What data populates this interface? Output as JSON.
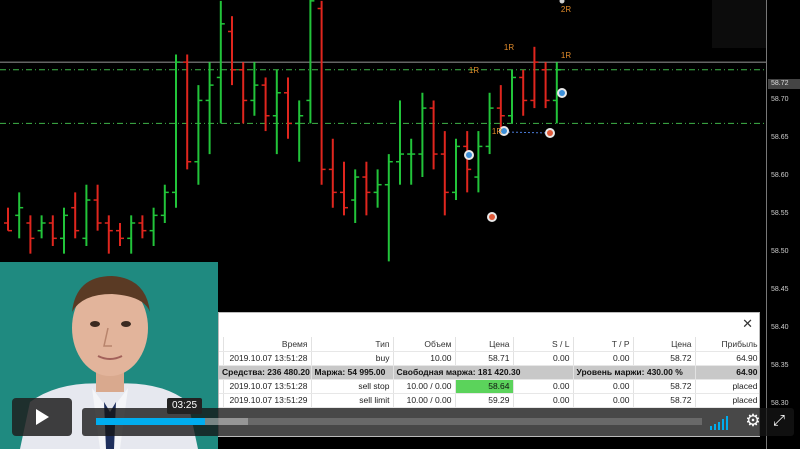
{
  "price_axis": {
    "current_price": "58.72",
    "labels": [
      "58.70",
      "58.65",
      "58.60",
      "58.55",
      "58.50",
      "58.45",
      "58.40",
      "58.35",
      "58.30"
    ]
  },
  "annotations": [
    "2R",
    "1R",
    "1R",
    "1R",
    "1R"
  ],
  "chart_data": {
    "type": "ohlc",
    "title": "",
    "ylim": [
      58.28,
      58.78
    ],
    "bars": [
      {
        "o": 58.51,
        "h": 58.53,
        "l": 58.5,
        "c": 58.5,
        "dir": "down"
      },
      {
        "o": 58.52,
        "h": 58.55,
        "l": 58.49,
        "c": 58.53,
        "dir": "up"
      },
      {
        "o": 58.51,
        "h": 58.52,
        "l": 58.47,
        "c": 58.49,
        "dir": "down"
      },
      {
        "o": 58.5,
        "h": 58.52,
        "l": 58.49,
        "c": 58.51,
        "dir": "up"
      },
      {
        "o": 58.51,
        "h": 58.52,
        "l": 58.48,
        "c": 58.49,
        "dir": "down"
      },
      {
        "o": 58.49,
        "h": 58.53,
        "l": 58.47,
        "c": 58.52,
        "dir": "up"
      },
      {
        "o": 58.53,
        "h": 58.55,
        "l": 58.49,
        "c": 58.5,
        "dir": "down"
      },
      {
        "o": 58.49,
        "h": 58.56,
        "l": 58.48,
        "c": 58.54,
        "dir": "up"
      },
      {
        "o": 58.54,
        "h": 58.56,
        "l": 58.5,
        "c": 58.51,
        "dir": "down"
      },
      {
        "o": 58.51,
        "h": 58.52,
        "l": 58.47,
        "c": 58.5,
        "dir": "down"
      },
      {
        "o": 58.5,
        "h": 58.51,
        "l": 58.48,
        "c": 58.49,
        "dir": "down"
      },
      {
        "o": 58.49,
        "h": 58.52,
        "l": 58.47,
        "c": 58.51,
        "dir": "up"
      },
      {
        "o": 58.51,
        "h": 58.52,
        "l": 58.49,
        "c": 58.5,
        "dir": "down"
      },
      {
        "o": 58.5,
        "h": 58.53,
        "l": 58.48,
        "c": 58.52,
        "dir": "up"
      },
      {
        "o": 58.52,
        "h": 58.56,
        "l": 58.51,
        "c": 58.55,
        "dir": "up"
      },
      {
        "o": 58.55,
        "h": 58.73,
        "l": 58.53,
        "c": 58.72,
        "dir": "up"
      },
      {
        "o": 58.72,
        "h": 58.73,
        "l": 58.58,
        "c": 58.59,
        "dir": "down"
      },
      {
        "o": 58.59,
        "h": 58.69,
        "l": 58.56,
        "c": 58.67,
        "dir": "up"
      },
      {
        "o": 58.67,
        "h": 58.72,
        "l": 58.6,
        "c": 58.69,
        "dir": "up"
      },
      {
        "o": 58.7,
        "h": 58.8,
        "l": 58.64,
        "c": 58.77,
        "dir": "up"
      },
      {
        "o": 58.76,
        "h": 58.78,
        "l": 58.69,
        "c": 58.71,
        "dir": "down"
      },
      {
        "o": 58.71,
        "h": 58.72,
        "l": 58.64,
        "c": 58.67,
        "dir": "down"
      },
      {
        "o": 58.67,
        "h": 58.72,
        "l": 58.65,
        "c": 58.69,
        "dir": "up"
      },
      {
        "o": 58.69,
        "h": 58.7,
        "l": 58.63,
        "c": 58.65,
        "dir": "down"
      },
      {
        "o": 58.65,
        "h": 58.71,
        "l": 58.6,
        "c": 58.68,
        "dir": "up"
      },
      {
        "o": 58.68,
        "h": 58.7,
        "l": 58.62,
        "c": 58.64,
        "dir": "down"
      },
      {
        "o": 58.64,
        "h": 58.67,
        "l": 58.59,
        "c": 58.65,
        "dir": "up"
      },
      {
        "o": 58.67,
        "h": 58.82,
        "l": 58.64,
        "c": 58.8,
        "dir": "up"
      },
      {
        "o": 58.79,
        "h": 58.8,
        "l": 58.56,
        "c": 58.58,
        "dir": "down"
      },
      {
        "o": 58.58,
        "h": 58.62,
        "l": 58.53,
        "c": 58.55,
        "dir": "down"
      },
      {
        "o": 58.55,
        "h": 58.59,
        "l": 58.52,
        "c": 58.53,
        "dir": "down"
      },
      {
        "o": 58.54,
        "h": 58.58,
        "l": 58.51,
        "c": 58.57,
        "dir": "up"
      },
      {
        "o": 58.57,
        "h": 58.59,
        "l": 58.52,
        "c": 58.55,
        "dir": "down"
      },
      {
        "o": 58.55,
        "h": 58.58,
        "l": 58.53,
        "c": 58.56,
        "dir": "up"
      },
      {
        "o": 58.56,
        "h": 58.6,
        "l": 58.46,
        "c": 58.59,
        "dir": "up"
      },
      {
        "o": 58.59,
        "h": 58.67,
        "l": 58.56,
        "c": 58.6,
        "dir": "up"
      },
      {
        "o": 58.6,
        "h": 58.62,
        "l": 58.56,
        "c": 58.6,
        "dir": "up"
      },
      {
        "o": 58.6,
        "h": 58.68,
        "l": 58.57,
        "c": 58.66,
        "dir": "up"
      },
      {
        "o": 58.66,
        "h": 58.67,
        "l": 58.58,
        "c": 58.6,
        "dir": "down"
      },
      {
        "o": 58.6,
        "h": 58.63,
        "l": 58.52,
        "c": 58.55,
        "dir": "down"
      },
      {
        "o": 58.55,
        "h": 58.62,
        "l": 58.54,
        "c": 58.61,
        "dir": "up"
      },
      {
        "o": 58.61,
        "h": 58.63,
        "l": 58.55,
        "c": 58.58,
        "dir": "down"
      },
      {
        "o": 58.57,
        "h": 58.63,
        "l": 58.55,
        "c": 58.61,
        "dir": "up"
      },
      {
        "o": 58.61,
        "h": 58.68,
        "l": 58.6,
        "c": 58.66,
        "dir": "up"
      },
      {
        "o": 58.66,
        "h": 58.69,
        "l": 58.63,
        "c": 58.65,
        "dir": "down"
      },
      {
        "o": 58.65,
        "h": 58.71,
        "l": 58.64,
        "c": 58.7,
        "dir": "up"
      },
      {
        "o": 58.7,
        "h": 58.71,
        "l": 58.65,
        "c": 58.67,
        "dir": "down"
      },
      {
        "o": 58.67,
        "h": 58.74,
        "l": 58.66,
        "c": 58.72,
        "dir": "down"
      },
      {
        "o": 58.71,
        "h": 58.72,
        "l": 58.66,
        "c": 58.67,
        "dir": "down"
      },
      {
        "o": 58.67,
        "h": 58.72,
        "l": 58.64,
        "c": 58.71,
        "dir": "up"
      }
    ],
    "levels": [
      {
        "price": 58.72,
        "style": "solid",
        "color": "#c8c8c8"
      },
      {
        "price": 58.71,
        "style": "dashdot",
        "color": "#3fb54a"
      },
      {
        "price": 58.64,
        "style": "dashdot",
        "color": "#3fb54a"
      }
    ]
  },
  "terminal": {
    "headers": [
      "",
      "Время",
      "Тип",
      "Объем",
      "Цена",
      "S / L",
      "T / P",
      "Цена",
      "Прибыль"
    ],
    "rows": [
      [
        "",
        "2019.10.07 13:51:28",
        "buy",
        "10.00",
        "58.71",
        "0.00",
        "0.00",
        "58.72",
        "64.90"
      ],
      [
        "",
        "2019.10.07 13:51:28",
        "sell stop",
        "10.00 / 0.00",
        "58.64",
        "0.00",
        "0.00",
        "58.72",
        "placed"
      ],
      [
        "",
        "2019.10.07 13:51:29",
        "sell limit",
        "10.00 / 0.00",
        "59.29",
        "0.00",
        "0.00",
        "58.72",
        "placed"
      ]
    ],
    "summary": {
      "funds": "Средства: 236 480.20",
      "margin": "Маржа: 54 995.00",
      "free_margin": "Свободная маржа: 181 420.30",
      "margin_level": "Уровень маржи: 430.00 %",
      "profit": "64.90"
    }
  },
  "player": {
    "time": "03:25",
    "progress": 0.18,
    "buffered": 0.25
  }
}
